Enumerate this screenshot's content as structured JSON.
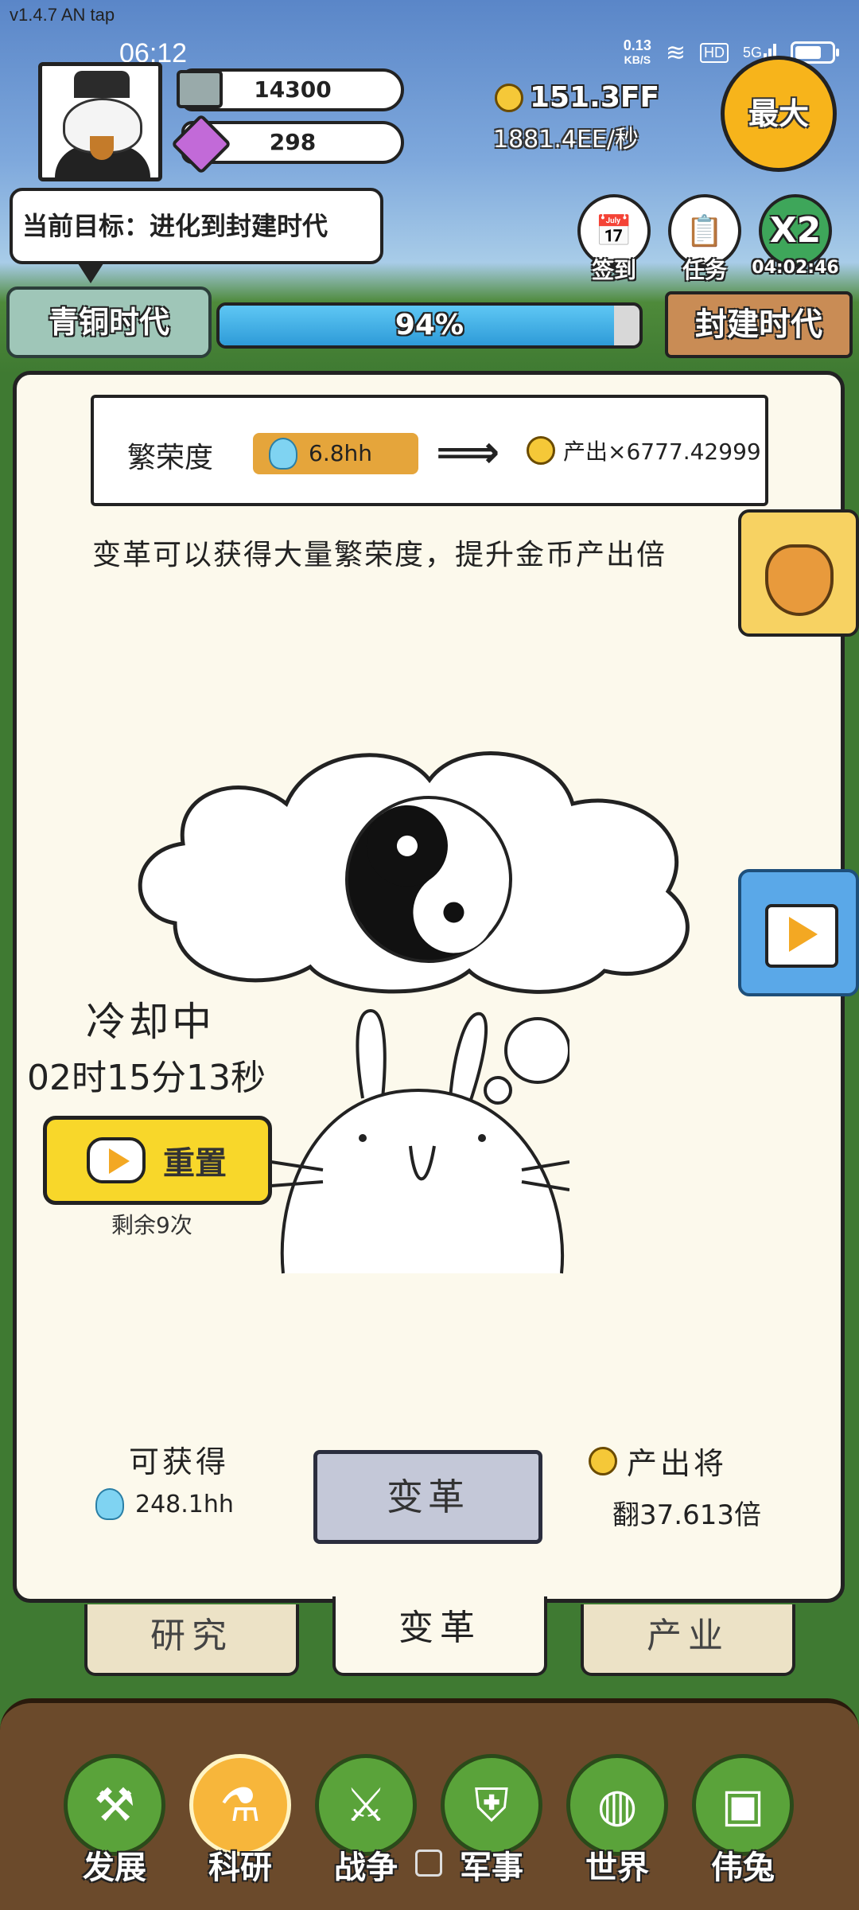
{
  "version": "v1.4.7 AN tap",
  "status_bar": {
    "time": "06:12",
    "net_speed_value": "0.13",
    "net_speed_unit": "KB/S",
    "hd": "HD",
    "signal": "5G"
  },
  "resources": {
    "silver": "14300",
    "gems": "298",
    "gold_total": "151.3FF",
    "gold_rate": "1881.4EE/秒"
  },
  "buttons": {
    "max": "最大",
    "signin": "签到",
    "tasks": "任务",
    "x2": "X2",
    "x2_timer": "04:02:46"
  },
  "goal": "当前目标：进化到封建时代",
  "age": {
    "current": "青铜时代",
    "next": "封建时代",
    "progress_text": "94%",
    "progress_value": 0.94
  },
  "reform": {
    "prosperity_label": "繁荣度",
    "prosperity_value": "6.8hh",
    "output_text": "产出×6777.42999",
    "description": "变革可以获得大量繁荣度，提升金币产出倍",
    "cooldown_label": "冷却中",
    "cooldown_timer": "02时15分13秒",
    "reset_label": "重置",
    "remaining": "剩余9次",
    "obtain_label": "可获得",
    "obtain_value": "248.1hh",
    "reform_button": "变革",
    "output_will": "产出将",
    "multiplier": "翻37.613倍"
  },
  "sub_tabs": [
    "研究",
    "变革",
    "产业"
  ],
  "nav": [
    {
      "label": "发展",
      "icon": "mace-icon"
    },
    {
      "label": "科研",
      "icon": "potion-icon"
    },
    {
      "label": "战争",
      "icon": "swords-icon"
    },
    {
      "label": "军事",
      "icon": "armor-icon"
    },
    {
      "label": "世界",
      "icon": "globe-icon"
    },
    {
      "label": "伟兔",
      "icon": "bunny-portrait-icon"
    }
  ]
}
